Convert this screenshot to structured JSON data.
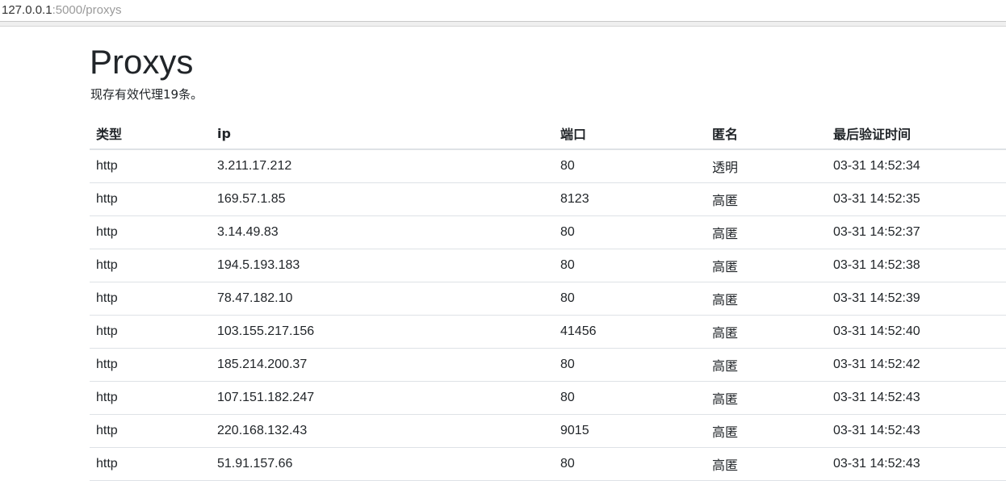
{
  "browser": {
    "url_host": "127.0.0.1",
    "url_rest": ":5000/proxys"
  },
  "page": {
    "title": "Proxys",
    "summary": "现存有效代理19条。"
  },
  "table": {
    "headers": {
      "type": "类型",
      "ip": "ip",
      "port": "端口",
      "anonymity": "匿名",
      "last_checked": "最后验证时间"
    },
    "rows": [
      {
        "type": "http",
        "ip": "3.211.17.212",
        "port": "80",
        "anonymity": "透明",
        "last_checked": "03-31 14:52:34"
      },
      {
        "type": "http",
        "ip": "169.57.1.85",
        "port": "8123",
        "anonymity": "高匿",
        "last_checked": "03-31 14:52:35"
      },
      {
        "type": "http",
        "ip": "3.14.49.83",
        "port": "80",
        "anonymity": "高匿",
        "last_checked": "03-31 14:52:37"
      },
      {
        "type": "http",
        "ip": "194.5.193.183",
        "port": "80",
        "anonymity": "高匿",
        "last_checked": "03-31 14:52:38"
      },
      {
        "type": "http",
        "ip": "78.47.182.10",
        "port": "80",
        "anonymity": "高匿",
        "last_checked": "03-31 14:52:39"
      },
      {
        "type": "http",
        "ip": "103.155.217.156",
        "port": "41456",
        "anonymity": "高匿",
        "last_checked": "03-31 14:52:40"
      },
      {
        "type": "http",
        "ip": "185.214.200.37",
        "port": "80",
        "anonymity": "高匿",
        "last_checked": "03-31 14:52:42"
      },
      {
        "type": "http",
        "ip": "107.151.182.247",
        "port": "80",
        "anonymity": "高匿",
        "last_checked": "03-31 14:52:43"
      },
      {
        "type": "http",
        "ip": "220.168.132.43",
        "port": "9015",
        "anonymity": "高匿",
        "last_checked": "03-31 14:52:43"
      },
      {
        "type": "http",
        "ip": "51.91.157.66",
        "port": "80",
        "anonymity": "高匿",
        "last_checked": "03-31 14:52:43"
      }
    ]
  }
}
